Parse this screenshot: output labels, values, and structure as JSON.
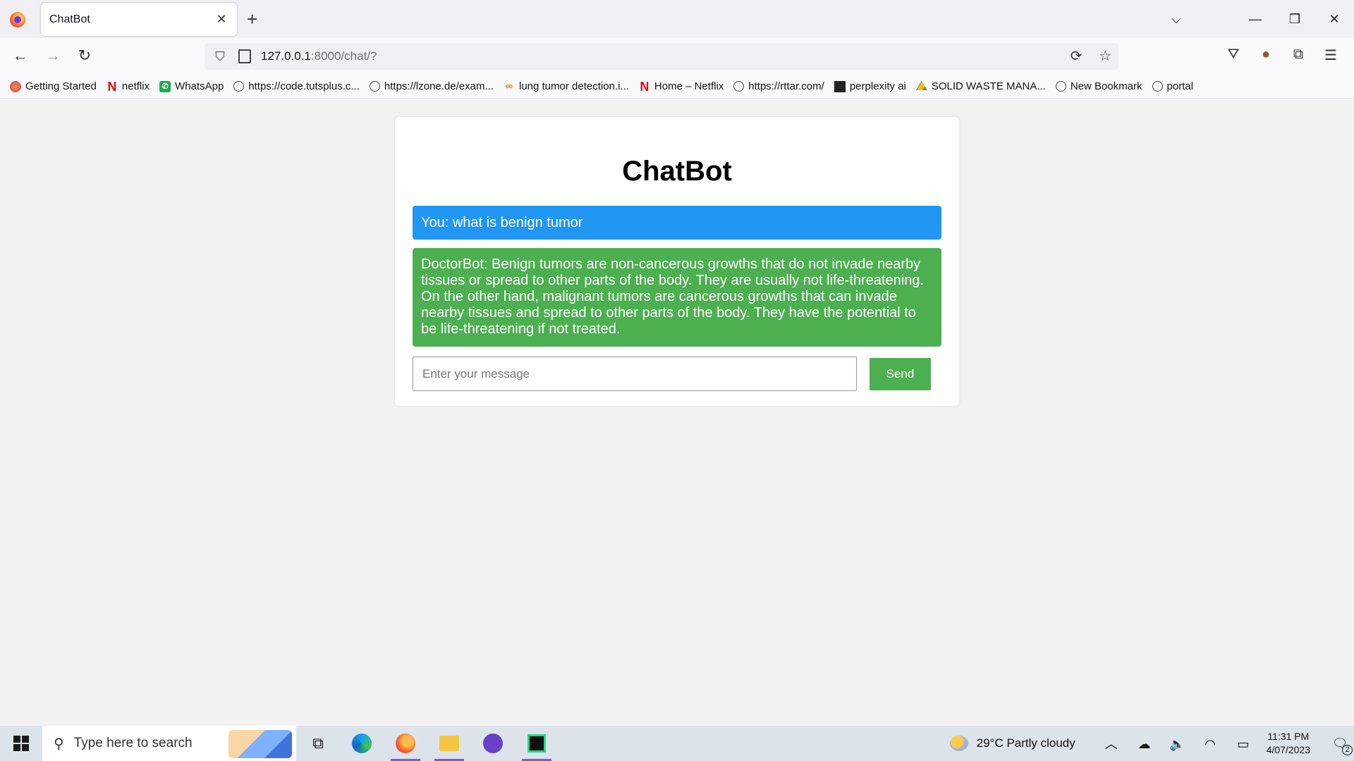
{
  "browser": {
    "tab_title": "ChatBot",
    "tab_close": "✕",
    "new_tab": "+",
    "url_host": "127.0.0.1",
    "url_path": ":8000/chat/?",
    "window_controls": {
      "list_tabs": "⌵",
      "minimize": "—",
      "restore": "❐",
      "close": "✕"
    },
    "bookmarks": [
      {
        "label": "Getting Started",
        "icon": "firefox-icon"
      },
      {
        "label": "netflix",
        "icon": "netflix-icon"
      },
      {
        "label": "WhatsApp",
        "icon": "whatsapp-icon"
      },
      {
        "label": "https://code.tutsplus.c...",
        "icon": "globe-icon"
      },
      {
        "label": "https://lzone.de/exam...",
        "icon": "globe-icon"
      },
      {
        "label": "lung tumor detection.i...",
        "icon": "colab-icon"
      },
      {
        "label": "Home – Netflix",
        "icon": "netflix-icon"
      },
      {
        "label": "https://rttar.com/",
        "icon": "globe-icon"
      },
      {
        "label": "perplexity ai",
        "icon": "perplexity-icon"
      },
      {
        "label": "SOLID WASTE MANA...",
        "icon": "drive-icon"
      },
      {
        "label": "New Bookmark",
        "icon": "globe-icon"
      },
      {
        "label": "portal",
        "icon": "globe-icon"
      }
    ]
  },
  "chat": {
    "title": "ChatBot",
    "messages": [
      {
        "sender": "user",
        "text": "You: what is benign tumor",
        "color": "#2196f3"
      },
      {
        "sender": "bot",
        "text": "DoctorBot: Benign tumors are non-cancerous growths that do not invade nearby tissues or spread to other parts of the body. They are usually not life-threatening. On the other hand, malignant tumors are cancerous growths that can invade nearby tissues and spread to other parts of the body. They have the potential to be life-threatening if not treated.",
        "color": "#4caf50"
      }
    ],
    "input_placeholder": "Enter your message",
    "input_value": "",
    "send_label": "Send"
  },
  "taskbar": {
    "search_placeholder": "Type here to search",
    "weather": "29°C  Partly cloudy",
    "time": "11:31 PM",
    "date": "4/07/2023",
    "notification_count": "2"
  }
}
